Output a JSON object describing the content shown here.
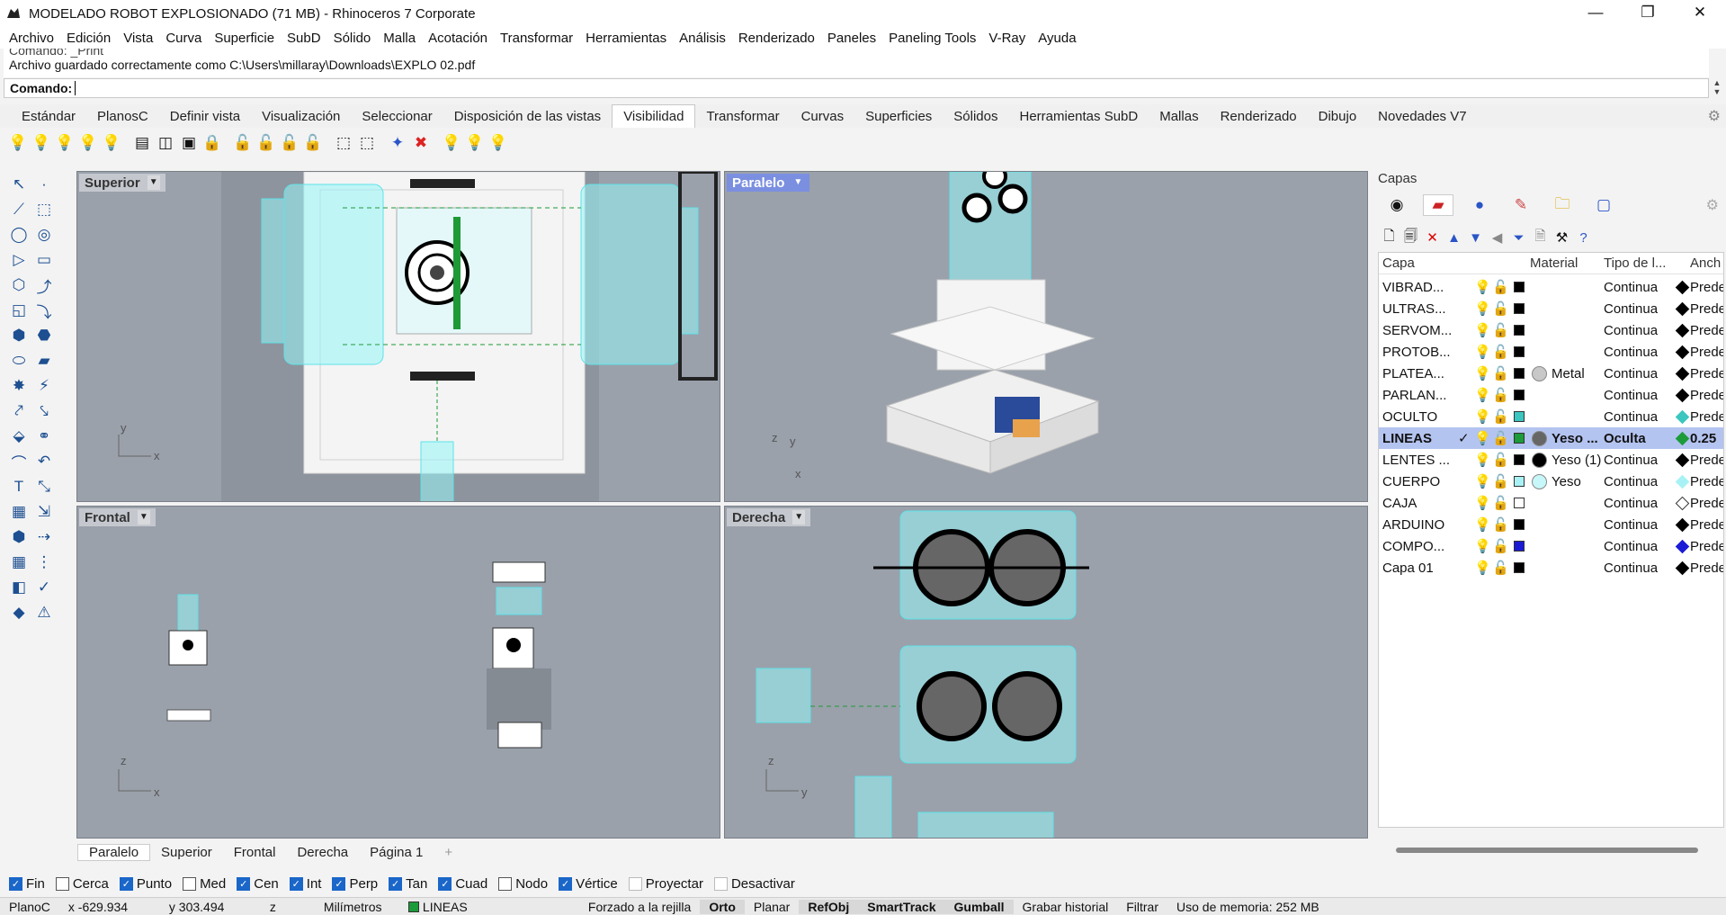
{
  "window": {
    "title": "MODELADO ROBOT EXPLOSIONADO (71 MB) - Rhinoceros 7 Corporate",
    "controls": [
      "—",
      "❐",
      "✕"
    ]
  },
  "menu": [
    "Archivo",
    "Edición",
    "Vista",
    "Curva",
    "Superficie",
    "SubD",
    "Sólido",
    "Malla",
    "Acotación",
    "Transformar",
    "Herramientas",
    "Análisis",
    "Renderizado",
    "Paneles",
    "Paneling Tools",
    "V-Ray",
    "Ayuda"
  ],
  "command": {
    "history_line1": "Comando: _Print",
    "history_line2": "Archivo guardado correctamente como C:\\Users\\millaray\\Downloads\\EXPLO 02.pdf",
    "prompt": "Comando:",
    "value": ""
  },
  "toolbar_tabs": [
    "Estándar",
    "PlanosC",
    "Definir vista",
    "Visualización",
    "Seleccionar",
    "Disposición de las vistas",
    "Visibilidad",
    "Transformar",
    "Curvas",
    "Superficies",
    "Sólidos",
    "Herramientas SubD",
    "Mallas",
    "Renderizado",
    "Dibujo",
    "Novedades V7"
  ],
  "active_toolbar_tab": "Visibilidad",
  "toolbar_icons": [
    "bulb-icon",
    "bulb-icon",
    "bulb-icon",
    "bulb-icon",
    "bulb-icon",
    "layer-icon",
    "layer-icon",
    "layer-icon",
    "lock-icon",
    "lock-icon",
    "lock-icon",
    "lock-icon",
    "lock-icon",
    "isolate-icon",
    "isolate-icon",
    "select-icon",
    "select-icon",
    "bulb-icon",
    "bulb-icon",
    "bulb-icon"
  ],
  "viewports": {
    "top": {
      "label": "Superior",
      "axis_v": "y",
      "axis_h": "x"
    },
    "perspective": {
      "label": "Paralelo",
      "axis_v": "y",
      "axis_z": "z",
      "axis_h": "x"
    },
    "front": {
      "label": "Frontal",
      "axis_v": "z",
      "axis_h": "x"
    },
    "right": {
      "label": "Derecha",
      "axis_v": "z",
      "axis_h": "y"
    }
  },
  "viewport_tabs": [
    "Paralelo",
    "Superior",
    "Frontal",
    "Derecha",
    "Página 1",
    "+"
  ],
  "osnaps": [
    {
      "label": "Fin",
      "checked": true
    },
    {
      "label": "Cerca",
      "checked": false
    },
    {
      "label": "Punto",
      "checked": true
    },
    {
      "label": "Med",
      "checked": false
    },
    {
      "label": "Cen",
      "checked": true
    },
    {
      "label": "Int",
      "checked": true
    },
    {
      "label": "Perp",
      "checked": true
    },
    {
      "label": "Tan",
      "checked": true
    },
    {
      "label": "Cuad",
      "checked": true
    },
    {
      "label": "Nodo",
      "checked": false
    },
    {
      "label": "Vértice",
      "checked": true
    },
    {
      "label": "Proyectar",
      "checked": false
    },
    {
      "label": "Desactivar",
      "checked": false
    }
  ],
  "status": {
    "cplane": "PlanoC",
    "x": "x -629.934",
    "y": "y 303.494",
    "z": "z",
    "units": "Milímetros",
    "layer": "LINEAS",
    "grid_snap": "Forzado a la rejilla",
    "ortho": "Orto",
    "planar": "Planar",
    "osnap": "RefObj",
    "smarttrack": "SmartTrack",
    "gumball": "Gumball",
    "history": "Grabar historial",
    "filter": "Filtrar",
    "memory": "Uso de memoria: 252 MB"
  },
  "layers_panel": {
    "title": "Capas",
    "columns": [
      "Capa",
      "Material",
      "Tipo de l...",
      "Anch"
    ],
    "rows": [
      {
        "name": "VIBRAD...",
        "color": "#000000",
        "material": "",
        "linetype": "Continua",
        "width": "Prede",
        "diamond": "#000000"
      },
      {
        "name": "ULTRAS...",
        "color": "#000000",
        "material": "",
        "linetype": "Continua",
        "width": "Prede",
        "diamond": "#000000"
      },
      {
        "name": "SERVOM...",
        "color": "#000000",
        "material": "",
        "linetype": "Continua",
        "width": "Prede",
        "diamond": "#000000"
      },
      {
        "name": "PROTOB...",
        "color": "#000000",
        "material": "",
        "linetype": "Continua",
        "width": "Prede",
        "diamond": "#000000"
      },
      {
        "name": "PLATEA...",
        "color": "#000000",
        "material": "Metal",
        "matcolor": "#c8c8c8",
        "linetype": "Continua",
        "width": "Prede",
        "diamond": "#000000"
      },
      {
        "name": "PARLAN...",
        "color": "#000000",
        "material": "",
        "linetype": "Continua",
        "width": "Prede",
        "diamond": "#000000"
      },
      {
        "name": "OCULTO",
        "color": "#3cc6c0",
        "material": "",
        "linetype": "Continua",
        "width": "Prede",
        "diamond": "#3cc6c0"
      },
      {
        "name": "LINEAS",
        "color": "#1c9b3a",
        "material": "Yeso ...",
        "matcolor": "#666666",
        "linetype": "Oculta",
        "width": "0.25",
        "diamond": "#1c9b3a",
        "current": true
      },
      {
        "name": "LENTES ...",
        "color": "#000000",
        "material": "Yeso (1)",
        "matcolor": "#000000",
        "linetype": "Continua",
        "width": "Prede",
        "diamond": "#000000"
      },
      {
        "name": "CUERPO",
        "color": "#a8f2f5",
        "material": "Yeso",
        "matcolor": "#c8f7f9",
        "linetype": "Continua",
        "width": "Prede",
        "diamond": "#a8f2f5"
      },
      {
        "name": "CAJA",
        "color": "#ffffff",
        "material": "",
        "linetype": "Continua",
        "width": "Prede",
        "diamond": "#ffffff"
      },
      {
        "name": "ARDUINO",
        "color": "#000000",
        "material": "",
        "linetype": "Continua",
        "width": "Prede",
        "diamond": "#000000"
      },
      {
        "name": "COMPO...",
        "color": "#1b1bd6",
        "material": "",
        "linetype": "Continua",
        "width": "Prede",
        "diamond": "#1b1bd6"
      },
      {
        "name": "Capa 01",
        "color": "#000000",
        "material": "",
        "linetype": "Continua",
        "width": "Prede",
        "diamond": "#000000"
      }
    ]
  },
  "colors": {
    "viewport_bg": "#9aa1ab",
    "accent": "#1a66c9",
    "selected_row": "#b4c4f0",
    "wireframe": "#5de3e8"
  }
}
